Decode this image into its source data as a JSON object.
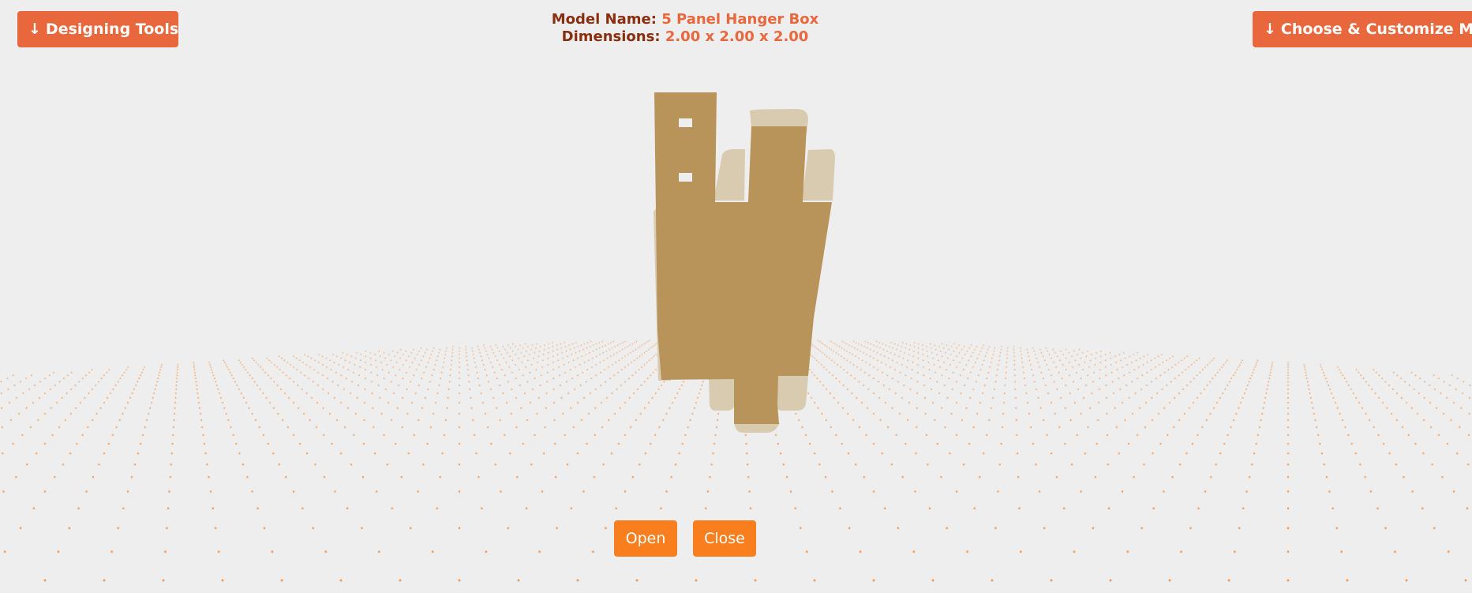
{
  "toolbar": {
    "designing_tools_label": "Designing Tools",
    "customize_label": "Choose & Customize Mod",
    "arrow_icon": "arrow-down-icon"
  },
  "model": {
    "name_label": "Model Name:",
    "name_value": "5 Panel Hanger Box",
    "dimensions_label": "Dimensions:",
    "dimensions_value": "2.00 x 2.00 x 2.00"
  },
  "controls": {
    "open_label": "Open",
    "close_label": "Close"
  },
  "colors": {
    "background": "#eeeeee",
    "accent": "#e8673c",
    "label_text": "#8a2e10",
    "control_button": "#f97f1e",
    "grid_dot": "#f57c1f",
    "panel_front": "#b8935a",
    "panel_back": "#d8cbb0"
  }
}
